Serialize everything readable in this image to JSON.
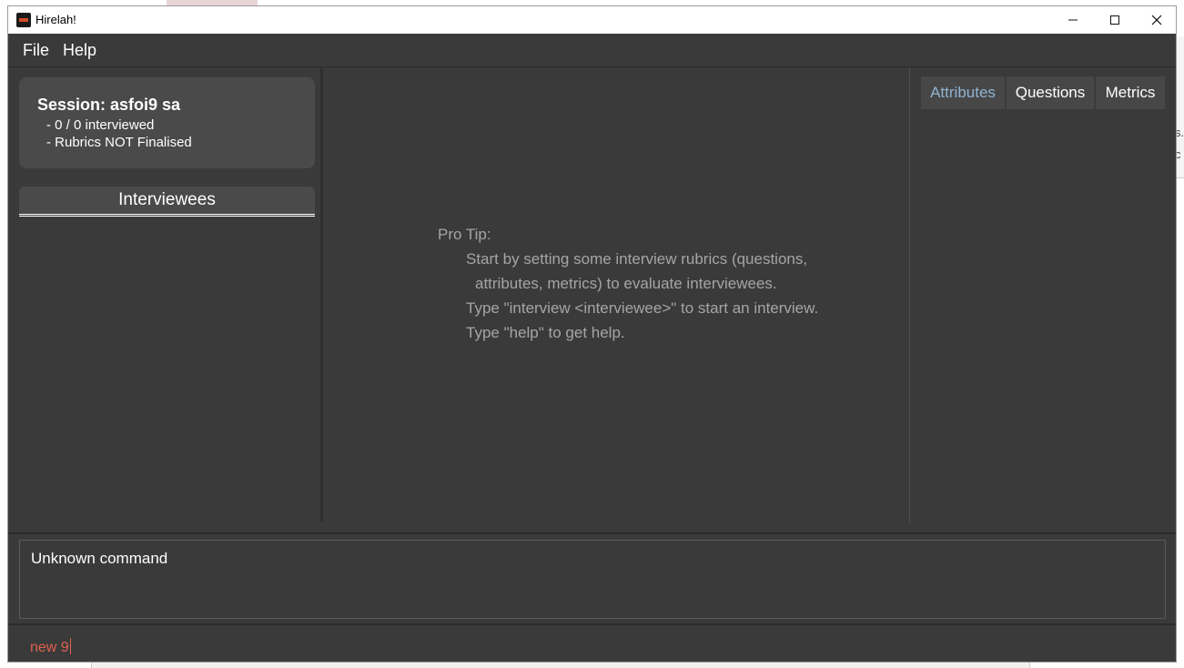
{
  "window": {
    "title": "Hirelah!",
    "controls": {
      "minimize": "─",
      "maximize": "☐",
      "close": "✕"
    }
  },
  "menu": {
    "file": "File",
    "help": "Help"
  },
  "session": {
    "title": "Session: asfoi9 sa",
    "interviewed": "- 0 / 0 interviewed",
    "rubrics": "- Rubrics NOT Finalised"
  },
  "interviewees": {
    "header": "Interviewees"
  },
  "protip": {
    "heading": "Pro Tip:",
    "line1": "Start by setting some interview rubrics (questions,",
    "line2": "attributes, metrics) to evaluate interviewees.",
    "line3": "Type \"interview <interviewee>\" to start an interview.",
    "line4": "Type \"help\" to get help."
  },
  "tabs": {
    "attributes": "Attributes",
    "questions": "Questions",
    "metrics": "Metrics",
    "active": "attributes"
  },
  "result": {
    "text": "Unknown command"
  },
  "command": {
    "value": "new 9"
  },
  "background": {
    "snippet1": "s.",
    "snippet2": "c"
  },
  "colors": {
    "window_bg": "#3a3a3a",
    "card_bg": "#4a4a4a",
    "active_tab": "#8fb3d3",
    "command_text": "#e0614f"
  }
}
